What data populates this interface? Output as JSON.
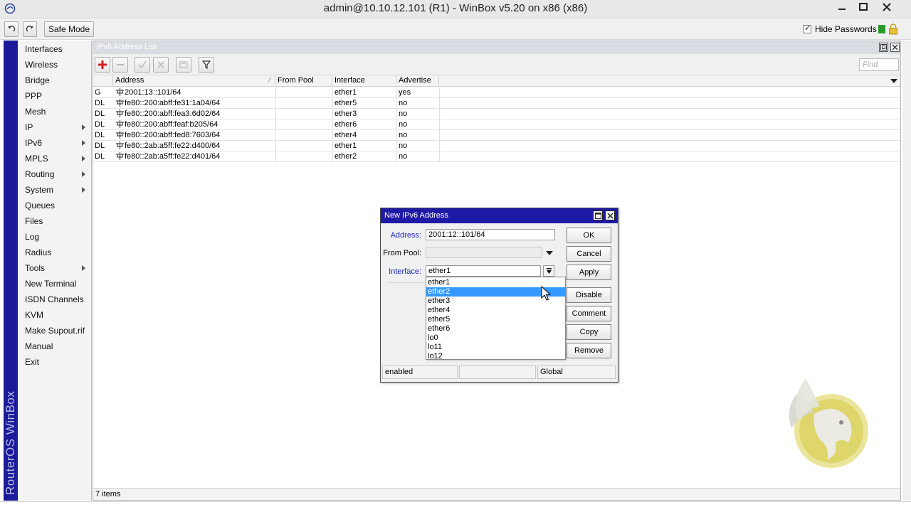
{
  "window": {
    "title": "admin@10.10.12.101 (R1) - WinBox v5.20 on x86 (x86)"
  },
  "toolbar": {
    "safe_mode": "Safe Mode",
    "hide_passwords": "Hide Passwords",
    "hide_passwords_checked": true
  },
  "brand": {
    "vertical_text": "RouterOS WinBox"
  },
  "sidebar": {
    "items": [
      {
        "label": "Interfaces",
        "submenu": false
      },
      {
        "label": "Wireless",
        "submenu": false
      },
      {
        "label": "Bridge",
        "submenu": false
      },
      {
        "label": "PPP",
        "submenu": false
      },
      {
        "label": "Mesh",
        "submenu": false
      },
      {
        "label": "IP",
        "submenu": true
      },
      {
        "label": "IPv6",
        "submenu": true
      },
      {
        "label": "MPLS",
        "submenu": true
      },
      {
        "label": "Routing",
        "submenu": true
      },
      {
        "label": "System",
        "submenu": true
      },
      {
        "label": "Queues",
        "submenu": false
      },
      {
        "label": "Files",
        "submenu": false
      },
      {
        "label": "Log",
        "submenu": false
      },
      {
        "label": "Radius",
        "submenu": false
      },
      {
        "label": "Tools",
        "submenu": true
      },
      {
        "label": "New Terminal",
        "submenu": false
      },
      {
        "label": "ISDN Channels",
        "submenu": false
      },
      {
        "label": "KVM",
        "submenu": false
      },
      {
        "label": "Make Supout.rif",
        "submenu": false
      },
      {
        "label": "Manual",
        "submenu": false
      },
      {
        "label": "Exit",
        "submenu": false
      }
    ]
  },
  "pane": {
    "title": "IPv6 Address List",
    "find_placeholder": "Find",
    "columns": [
      "Address",
      "From Pool",
      "Interface",
      "Advertise"
    ],
    "rows": [
      {
        "flags": "G",
        "address": "2001:13::101/64",
        "from_pool": "",
        "interface": "ether1",
        "advertise": "yes"
      },
      {
        "flags": "DL",
        "address": "fe80::200:abff:fe31:1a04/64",
        "from_pool": "",
        "interface": "ether5",
        "advertise": "no"
      },
      {
        "flags": "DL",
        "address": "fe80::200:abff:fea3:6d02/64",
        "from_pool": "",
        "interface": "ether3",
        "advertise": "no"
      },
      {
        "flags": "DL",
        "address": "fe80::200:abff:feaf:b205/64",
        "from_pool": "",
        "interface": "ether6",
        "advertise": "no"
      },
      {
        "flags": "DL",
        "address": "fe80::200:abff:fed8:7603/64",
        "from_pool": "",
        "interface": "ether4",
        "advertise": "no"
      },
      {
        "flags": "DL",
        "address": "fe80::2ab:a5ff:fe22:d400/64",
        "from_pool": "",
        "interface": "ether1",
        "advertise": "no"
      },
      {
        "flags": "DL",
        "address": "fe80::2ab:a5ff:fe22:d401/64",
        "from_pool": "",
        "interface": "ether2",
        "advertise": "no"
      }
    ],
    "status": "7 items"
  },
  "dialog": {
    "title": "New IPv6 Address",
    "address_label": "Address:",
    "address_value": "2001:12::101/64",
    "from_pool_label": "From Pool:",
    "from_pool_value": "",
    "interface_label": "Interface:",
    "interface_value": "ether1",
    "buttons": [
      "OK",
      "Cancel",
      "Apply",
      "Disable",
      "Comment",
      "Copy",
      "Remove"
    ],
    "status": [
      "enabled",
      "",
      "Global"
    ],
    "dropdown_options": [
      "ether1",
      "ether2",
      "ether3",
      "ether4",
      "ether5",
      "ether6",
      "lo0",
      "lo11",
      "lo12"
    ],
    "dropdown_selected": "ether2"
  },
  "colors": {
    "brand_band": "#1b1b9a",
    "dialog_title": "#1f1aa6",
    "selection": "#3399ff",
    "label_blue": "#1c27b8"
  }
}
